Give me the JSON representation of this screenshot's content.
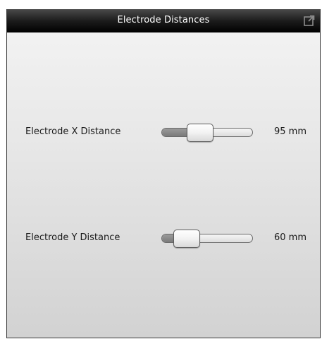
{
  "window": {
    "title": "Electrode Distances",
    "popout_icon": "popout-icon"
  },
  "sliders": [
    {
      "label": "Electrode X Distance",
      "value_text": "95 mm",
      "position_fraction": 0.39
    },
    {
      "label": "Electrode Y Distance",
      "value_text": "60 mm",
      "position_fraction": 0.19
    }
  ],
  "colors": {
    "titlebar": "#000000",
    "title_text": "#ffffff",
    "panel_bg": "#e6e6e6",
    "slider_fill": "#808080"
  }
}
